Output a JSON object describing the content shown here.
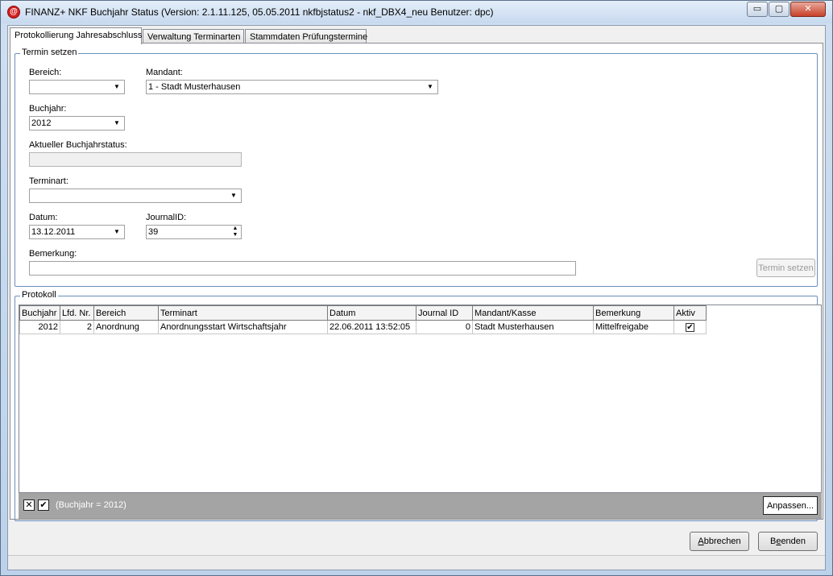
{
  "window": {
    "title": "FINANZ+ NKF Buchjahr Status (Version: 2.1.11.125, 05.05.2011 nkfbjstatus2 - nkf_DBX4_neu Benutzer: dpc)",
    "app_icon_glyph": "@",
    "minimize_glyph": "▭",
    "maximize_glyph": "▢",
    "close_glyph": "✕"
  },
  "tabs": [
    {
      "label": "Protokollierung Jahresabschluss"
    },
    {
      "label": "Verwaltung Terminarten"
    },
    {
      "label": "Stammdaten Prüfungstermine"
    }
  ],
  "termin_group": {
    "legend": "Termin setzen",
    "bereich_label": "Bereich:",
    "bereich_value": "",
    "mandant_label": "Mandant:",
    "mandant_value": "1 - Stadt Musterhausen",
    "buchjahr_label": "Buchjahr:",
    "buchjahr_value": "2012",
    "status_label": "Aktueller Buchjahrstatus:",
    "status_value": "",
    "terminart_label": "Terminart:",
    "terminart_value": "",
    "datum_label": "Datum:",
    "datum_value": "13.12.2011",
    "journalid_label": "JournalID:",
    "journalid_value": "39",
    "bemerkung_label": "Bemerkung:",
    "bemerkung_value": "",
    "submit_label": "Termin setzen",
    "dropdown_glyph": "▼",
    "spin_up_glyph": "▲",
    "spin_down_glyph": "▼"
  },
  "protokoll": {
    "legend": "Protokoll",
    "columns": [
      "Buchjahr",
      "Lfd. Nr.",
      "Bereich",
      "Terminart",
      "Datum",
      "Journal ID",
      "Mandant/Kasse",
      "Bemerkung",
      "Aktiv"
    ],
    "rows": [
      {
        "buchjahr": "2012",
        "lfd_nr": "2",
        "bereich": "Anordnung",
        "terminart": "Anordnungsstart Wirtschaftsjahr",
        "datum": "22.06.2011 13:52:05",
        "journal_id": "0",
        "mandant": "Stadt Musterhausen",
        "bemerkung": "Mittelfreigabe",
        "aktiv_glyph": "✔"
      }
    ],
    "filter_clear_glyph": "✕",
    "filter_toggle_glyph": "✔",
    "filter_text": "(Buchjahr = 2012)",
    "customize_label": "Anpassen..."
  },
  "footer": {
    "cancel_prefix": "",
    "cancel_accel": "A",
    "cancel_rest": "bbrechen",
    "close_prefix": "B",
    "close_accel": "e",
    "close_rest": "enden"
  }
}
